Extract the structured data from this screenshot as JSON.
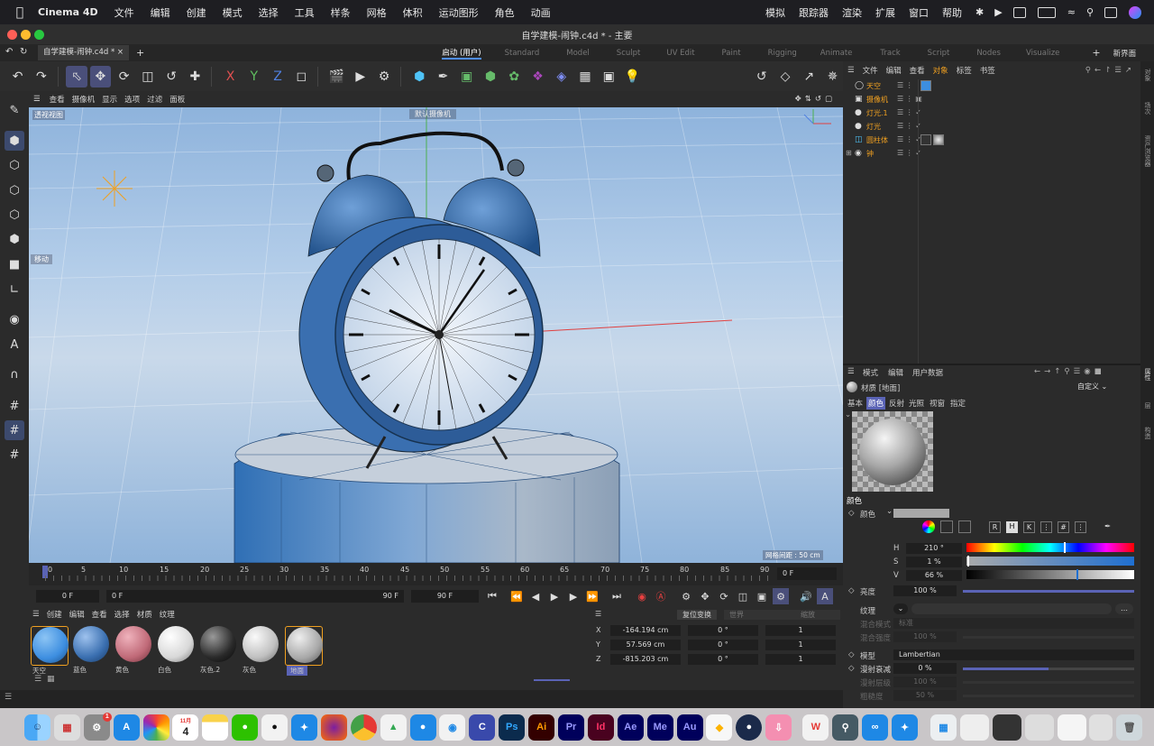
{
  "menubar": {
    "items": [
      "Cinema 4D",
      "文件",
      "编辑",
      "创建",
      "模式",
      "选择",
      "工具",
      "样条",
      "网格",
      "体积",
      "运动图形",
      "角色",
      "动画"
    ],
    "right_items": [
      "模拟",
      "跟踪器",
      "渲染",
      "扩展",
      "窗口",
      "帮助"
    ]
  },
  "window": {
    "title": "自学建模-闹钟.c4d * - 主要"
  },
  "tabs": {
    "doc_tab": "自学建模-闹钟.c4d *",
    "layouts": [
      "启动 (用户)",
      "Standard",
      "Model",
      "Sculpt",
      "UV Edit",
      "Paint",
      "Rigging",
      "Animate",
      "Track",
      "Script",
      "Nodes",
      "Visualize"
    ],
    "active_layout": "启动 (用户)",
    "new_layout": "新界面"
  },
  "toolbar": {
    "icons": [
      "undo-icon",
      "redo-icon",
      "select-icon",
      "move-icon",
      "rotate-icon",
      "scale-icon",
      "transform-icon",
      "model-icon",
      "x-axis-icon",
      "y-axis-icon",
      "z-axis-icon",
      "world-coord-icon",
      "render-region-icon",
      "render-view-icon",
      "render-settings-icon",
      "cube-icon",
      "pen-icon",
      "subdivision-icon",
      "array-icon",
      "cloner-icon",
      "deformer-icon",
      "field-icon",
      "floor-icon",
      "camera-icon",
      "light-icon"
    ],
    "axis_labels": [
      "X",
      "Y",
      "Z"
    ]
  },
  "viewport": {
    "menu": [
      "查看",
      "摄像机",
      "显示",
      "选项",
      "过滤",
      "面板"
    ],
    "label": "透视视图",
    "camera_label": "默认摄像机",
    "move_label": "移动",
    "grid_spacing": "网格间距 : 50 cm"
  },
  "timeline": {
    "ticks": [
      "0",
      "5",
      "10",
      "15",
      "20",
      "25",
      "30",
      "35",
      "40",
      "45",
      "50",
      "55",
      "60",
      "65",
      "70",
      "75",
      "80",
      "85",
      "90"
    ],
    "current_frame": "0 F",
    "start": "0 F",
    "start2": "0 F",
    "end": "90 F",
    "end2": "90 F"
  },
  "material_manager": {
    "menu": [
      "创建",
      "编辑",
      "查看",
      "选择",
      "材质",
      "纹理"
    ],
    "materials": [
      {
        "name": "天空",
        "color": "#3d8ee0"
      },
      {
        "name": "蓝色",
        "color": "#3a6fb0"
      },
      {
        "name": "黄色",
        "color": "#c06a78"
      },
      {
        "name": "白色",
        "color": "#d8d8d8"
      },
      {
        "name": "灰色.2",
        "color": "#2a2a2a"
      },
      {
        "name": "灰色",
        "color": "#c0c0c0"
      },
      {
        "name": "地面",
        "color": "#a8a8a8"
      }
    ]
  },
  "coordinates": {
    "tabs": [
      "复位变换",
      "世界",
      "缩放"
    ],
    "rows": [
      {
        "axis": "X",
        "pos": "-164.194 cm",
        "rot": "0 °",
        "scale": "1"
      },
      {
        "axis": "Y",
        "pos": "57.569 cm",
        "rot": "0 °",
        "scale": "1"
      },
      {
        "axis": "Z",
        "pos": "-815.203 cm",
        "rot": "0 °",
        "scale": "1"
      }
    ]
  },
  "object_manager": {
    "menu": [
      "文件",
      "编辑",
      "查看",
      "对象",
      "标签",
      "书签"
    ],
    "active_menu": "对象",
    "objects": [
      {
        "name": "天空",
        "icon": "sky-icon"
      },
      {
        "name": "摄像机",
        "icon": "camera-icon"
      },
      {
        "name": "灯光.1",
        "icon": "light-icon"
      },
      {
        "name": "灯光",
        "icon": "light-icon"
      },
      {
        "name": "圆柱体",
        "icon": "cylinder-icon"
      },
      {
        "name": "钟",
        "icon": "null-icon"
      }
    ]
  },
  "right_sidebar": {
    "tabs": [
      "对象",
      "场次",
      "资产浏览器",
      "属性",
      "层",
      "构造"
    ]
  },
  "attributes": {
    "menu": [
      "模式",
      "编辑",
      "用户数据"
    ],
    "title": "材质 [地面]",
    "preset": "自定义",
    "tabs": [
      "基本",
      "颜色",
      "反射",
      "光照",
      "视窗",
      "指定"
    ],
    "active_tab": "颜色",
    "section": "颜色",
    "color_label": "颜色",
    "channel_buttons": [
      "R",
      "H",
      "K"
    ],
    "h_label": "H",
    "h_value": "210 °",
    "s_label": "S",
    "s_value": "1 %",
    "v_label": "V",
    "v_value": "66 %",
    "brightness_label": "亮度",
    "brightness_value": "100 %",
    "texture_label": "纹理",
    "blend_mode_label": "混合模式",
    "blend_mode_value": "标准",
    "blend_strength_label": "混合强度",
    "blend_strength_value": "100 %",
    "model_label": "模型",
    "model_value": "Lambertian",
    "diffuse_falloff_label": "漫射衰减",
    "diffuse_falloff_value": "0 %",
    "diffuse_level_label": "漫射层级",
    "diffuse_level_value": "100 %",
    "roughness_label": "粗糙度",
    "roughness_value": "50 %"
  },
  "dock": {
    "calendar_day": "4",
    "calendar_month": "11月",
    "badge": "1",
    "apps": [
      "Finder",
      "Launchpad",
      "系统设置",
      "App Store",
      "照片",
      "日历",
      "备忘录",
      "微信",
      "QQ",
      "Safari",
      "Firefox",
      "Chrome",
      "Google Drive",
      "Teams",
      "Cinema 4D",
      "Photoshop",
      "Illustrator",
      "Premiere",
      "InDesign",
      "After Effects",
      "Media Encoder",
      "Audition",
      "Sketch",
      "Blender",
      "下载",
      "WPS",
      "搜索",
      "其它",
      "Safari 2",
      "预览",
      "废纸篓"
    ]
  }
}
